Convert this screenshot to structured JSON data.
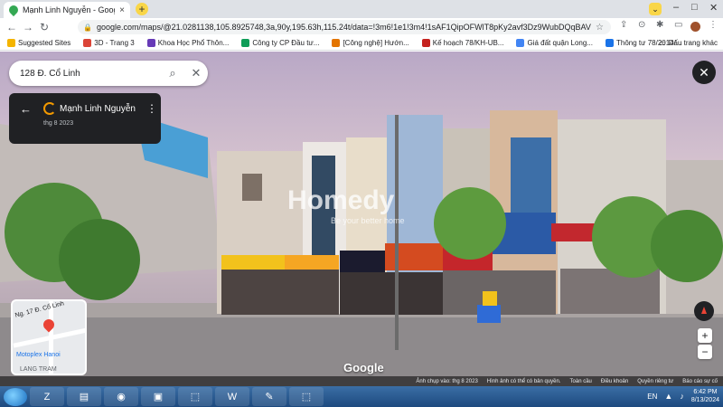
{
  "browser": {
    "tab_title": "Mạnh Linh Nguyễn - Google Ma",
    "url": "google.com/maps/@21.0281138,105.8925748,3a,90y,195.63h,115.24t/data=!3m6!1e1!3m4!1sAF1QipOFWlT8pKy2avf3Dz9WubDQqBAVU3IrP3kOWI...",
    "new_tab": "+",
    "tab_close": "×"
  },
  "bookmarks": [
    {
      "label": "Suggested Sites",
      "color": "#f4b400"
    },
    {
      "label": "3D - Trang 3",
      "color": "#db4437"
    },
    {
      "label": "Khoa Học Phổ Thôn...",
      "color": "#673ab7"
    },
    {
      "label": "Công ty CP Đầu tư...",
      "color": "#0f9d58"
    },
    {
      "label": "[Công nghệ] Hướn...",
      "color": "#e37400"
    },
    {
      "label": "Kế hoạch 78/KH-UB...",
      "color": "#c5221f"
    },
    {
      "label": "Giá đất quận Long...",
      "color": "#4285f4"
    },
    {
      "label": "Thông tư 78/2014/...",
      "color": "#1a73e8"
    }
  ],
  "bookmarks_right": "Dấu trang khác",
  "search": {
    "value": "128 Đ. Cổ Linh"
  },
  "info_card": {
    "name": "Mạnh Linh Nguyễn",
    "date": "thg 8 2023"
  },
  "minimap": {
    "street": "Ng. 17 Đ. Cổ Linh",
    "poi": "Motoplex Hanoi",
    "area": "LANG TRAM"
  },
  "watermark": {
    "main": "Homedy",
    "sub": "Be your better home"
  },
  "brand": "Google",
  "footer": [
    "Ảnh chụp vào: thg 8 2023",
    "Hình ảnh có thể có bản quyền.",
    "Toàn cầu",
    "Điều khoản",
    "Quyền riêng tư",
    "Báo cáo sự cố"
  ],
  "taskbar": {
    "apps": [
      "Zalo",
      "Files",
      "Chrome",
      "Monitor",
      "PDF",
      "Word",
      "Paint",
      "Access"
    ],
    "lang": "EN",
    "time": "6:42 PM",
    "date": "8/13/2024"
  }
}
